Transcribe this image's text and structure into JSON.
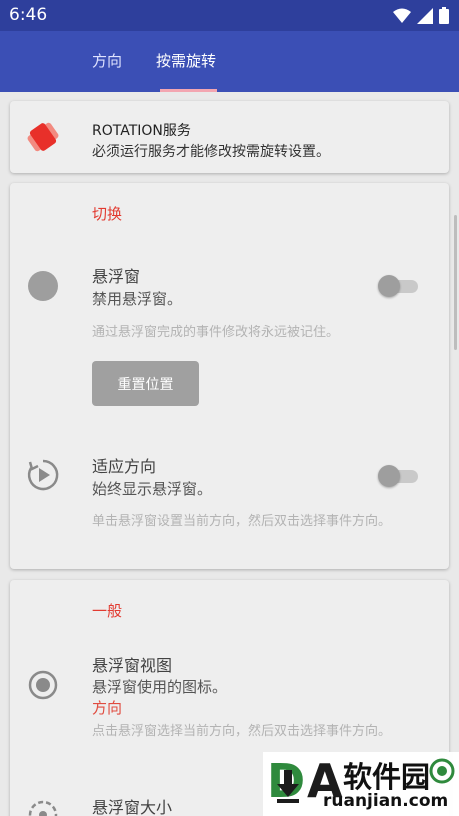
{
  "status_bar": {
    "time": "6:46"
  },
  "tabs": [
    {
      "label": "方向"
    },
    {
      "label": "按需旋转"
    }
  ],
  "service_card": {
    "title": "ROTATION服务",
    "summary": "必须运行服务才能修改按需旋转设置。"
  },
  "toggle_section": {
    "header": "切换",
    "floating_window": {
      "title": "悬浮窗",
      "summary": "禁用悬浮窗。",
      "description": "通过悬浮窗完成的事件修改将永远被记住。",
      "enabled": false
    },
    "reset_button": {
      "label": "重置位置"
    },
    "adapt_orientation": {
      "title": "适应方向",
      "summary": "始终显示悬浮窗。",
      "description": "单击悬浮窗设置当前方向，然后双击选择事件方向。",
      "enabled": false
    }
  },
  "general_section": {
    "header": "一般",
    "floating_view": {
      "title": "悬浮窗视图",
      "summary": "悬浮窗使用的图标。",
      "value": "方向",
      "description": "点击悬浮窗选择当前方向，然后双击选择事件方向。"
    },
    "floating_size": {
      "title": "悬浮窗大小"
    }
  },
  "watermark": {
    "letter_d": "D",
    "letter_a": "A",
    "name": "软件园",
    "url": "ruanjian.com"
  },
  "colors": {
    "status_bar": "#2e3f9c",
    "app_bar": "#3b4fb5",
    "accent": "#e23b31",
    "tab_indicator": "#f3a6b1"
  }
}
